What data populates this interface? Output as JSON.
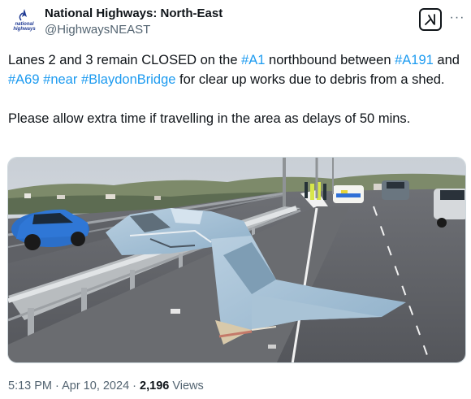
{
  "author": {
    "name": "National Highways: North-East",
    "handle": "@HighwaysNEAST",
    "avatar_text": "national highways",
    "avatar_color": "#1f3a93"
  },
  "actions": {
    "grok_icon": "grok-icon",
    "more_icon": "more-options-icon",
    "more_label": "···"
  },
  "tweet": {
    "segments": [
      {
        "text": "Lanes 2 and 3 remain CLOSED on the ",
        "tag": false
      },
      {
        "text": "#A1",
        "tag": true
      },
      {
        "text": " northbound between ",
        "tag": false
      },
      {
        "text": "#A191",
        "tag": true
      },
      {
        "text": " and ",
        "tag": false
      },
      {
        "text": "#A69",
        "tag": true
      },
      {
        "text": " ",
        "tag": false
      },
      {
        "text": "#near",
        "tag": true
      },
      {
        "text": " ",
        "tag": false
      },
      {
        "text": "#BlaydonBridge",
        "tag": true
      },
      {
        "text": "  for clear up works due to debris from a shed.",
        "tag": false
      }
    ],
    "paragraph2": "Please allow extra time if travelling in the area as delays of 50 mins.",
    "hashtag_color": "#1d9bf0"
  },
  "media": {
    "description_icon": "tweet-photo"
  },
  "meta": {
    "time": "5:13 PM",
    "separator1": " · ",
    "date": "Apr 10, 2024",
    "separator2": " · ",
    "views_count": "2,196",
    "views_label": " Views"
  }
}
